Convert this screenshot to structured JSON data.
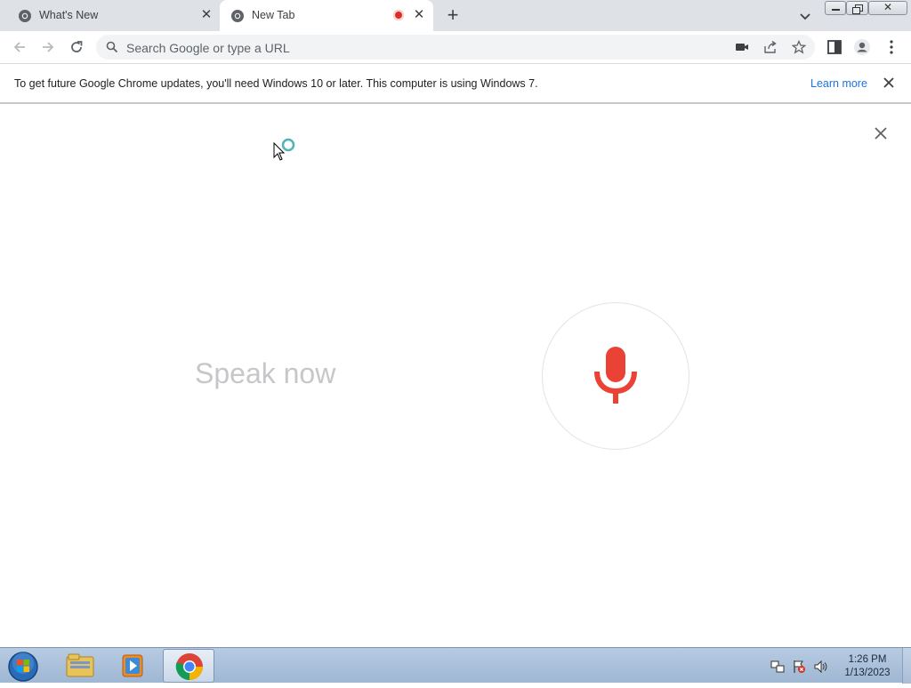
{
  "browser": {
    "tabs": [
      {
        "title": "What's New",
        "favicon": "chrome-icon",
        "active": false
      },
      {
        "title": "New Tab",
        "favicon": "chrome-icon",
        "active": true,
        "recording_indicator": true
      }
    ],
    "new_tab_symbol": "+",
    "omnibox": {
      "placeholder": "Search Google or type a URL",
      "value": ""
    },
    "toolbar_icons": [
      "back-icon",
      "forward-icon",
      "reload-icon",
      "camera-icon",
      "share-icon",
      "star-icon",
      "side-panel-icon",
      "profile-icon",
      "menu-icon"
    ]
  },
  "infobar": {
    "message": "To get future Google Chrome updates, you'll need Windows 10 or later. This computer is using Windows 7.",
    "link_label": "Learn more"
  },
  "voice_search": {
    "prompt": "Speak now",
    "mic_color": "#ea4335"
  },
  "taskbar": {
    "apps": [
      "windows-explorer",
      "windows-media-player",
      "google-chrome"
    ],
    "clock": {
      "time": "1:26 PM",
      "date": "1/13/2023"
    }
  }
}
